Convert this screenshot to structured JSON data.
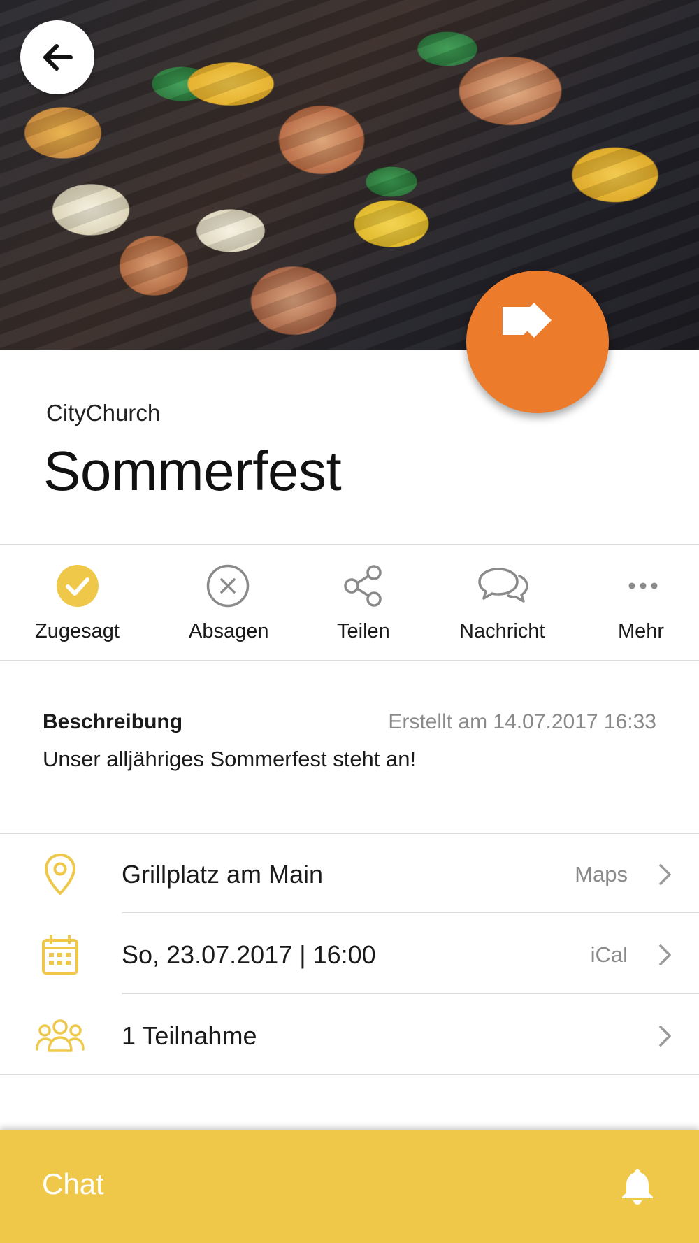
{
  "colors": {
    "accent_yellow": "#efc84a",
    "fab_orange": "#ec7b2c",
    "icon_gray": "#8a8a8a",
    "icon_yellow": "#efc84a"
  },
  "hero": {
    "image": "grilled-chicken-skewers-photo"
  },
  "header": {
    "organization": "CityChurch",
    "title": "Sommerfest"
  },
  "actions": [
    {
      "label": "Zugesagt",
      "icon": "check-circle-icon",
      "active": true
    },
    {
      "label": "Absagen",
      "icon": "close-circle-icon"
    },
    {
      "label": "Teilen",
      "icon": "share-icon"
    },
    {
      "label": "Nachricht",
      "icon": "chat-bubbles-icon"
    },
    {
      "label": "Mehr",
      "icon": "more-dots-icon"
    }
  ],
  "description": {
    "heading": "Beschreibung",
    "created": "Erstellt am 14.07.2017 16:33",
    "text": "Unser alljähriges Sommerfest steht an!"
  },
  "details": [
    {
      "icon": "location-pin-icon",
      "text": "Grillplatz am Main",
      "link": "Maps"
    },
    {
      "icon": "calendar-icon",
      "text": "So, 23.07.2017 | 16:00",
      "link": "iCal"
    },
    {
      "icon": "group-icon",
      "text": "1 Teilnahme",
      "link": ""
    }
  ],
  "chat": {
    "label": "Chat",
    "icon": "bell-icon"
  }
}
